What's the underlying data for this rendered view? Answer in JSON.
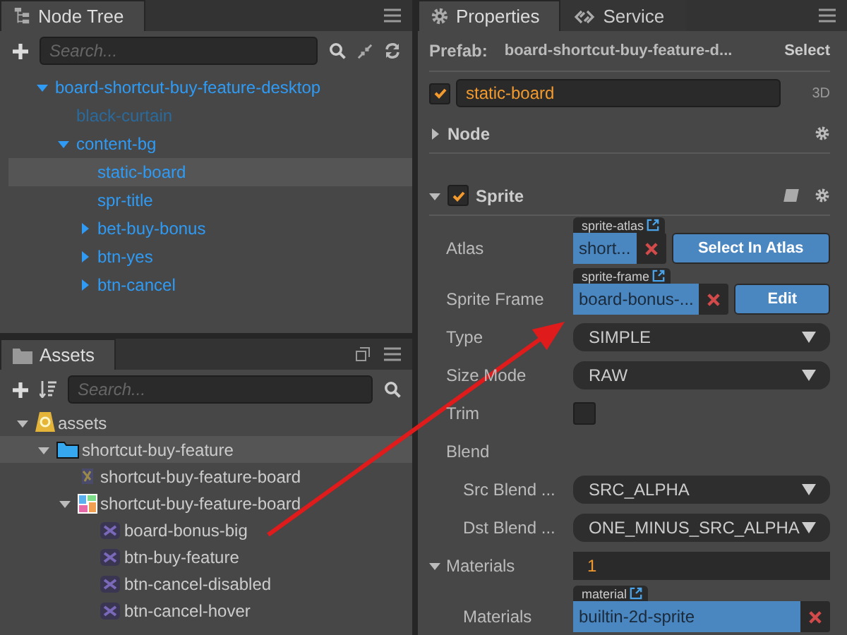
{
  "node_tree": {
    "title": "Node Tree",
    "search": {
      "placeholder": "Search..."
    },
    "nodes": [
      {
        "name": "board-shortcut-buy-feature-desktop",
        "expanded": true,
        "active": true,
        "selected": false,
        "children": [
          {
            "name": "black-curtain",
            "active": false,
            "selected": false
          },
          {
            "name": "content-bg",
            "expanded": true,
            "active": true,
            "selected": false,
            "children": [
              {
                "name": "static-board",
                "active": true,
                "selected": true
              },
              {
                "name": "spr-title",
                "active": true,
                "selected": false
              },
              {
                "name": "bet-buy-bonus",
                "expanded": false,
                "active": true,
                "selected": false
              },
              {
                "name": "btn-yes",
                "expanded": false,
                "active": true,
                "selected": false
              },
              {
                "name": "btn-cancel",
                "expanded": false,
                "active": true,
                "selected": false
              }
            ]
          }
        ]
      }
    ]
  },
  "assets": {
    "title": "Assets",
    "search": {
      "placeholder": "Search..."
    },
    "items": [
      {
        "name": "assets",
        "kind": "mount",
        "expanded": true,
        "selected": false,
        "children": [
          {
            "name": "shortcut-buy-feature",
            "kind": "folder",
            "expanded": true,
            "selected": true,
            "children": [
              {
                "name": "shortcut-buy-feature-board",
                "kind": "texture",
                "selected": false
              },
              {
                "name": "shortcut-buy-feature-board",
                "kind": "atlas",
                "expanded": true,
                "selected": false,
                "children": [
                  {
                    "name": "board-bonus-big",
                    "kind": "sprite",
                    "selected": false
                  },
                  {
                    "name": "btn-buy-feature",
                    "kind": "sprite",
                    "selected": false
                  },
                  {
                    "name": "btn-cancel-disabled",
                    "kind": "sprite",
                    "selected": false
                  },
                  {
                    "name": "btn-cancel-hover",
                    "kind": "sprite",
                    "selected": false
                  }
                ]
              }
            ]
          }
        ]
      }
    ]
  },
  "properties": {
    "tabs": [
      {
        "label": "Properties",
        "selected": true
      },
      {
        "label": "Service",
        "selected": false
      }
    ],
    "prefab": {
      "label": "Prefab:",
      "value": "board-shortcut-buy-feature-d...",
      "button": "Select"
    },
    "node": {
      "checked": true,
      "name": "static-board",
      "mode": "3D"
    },
    "sections": [
      {
        "title": "Node",
        "expanded": false
      },
      {
        "title": "Sprite",
        "expanded": true,
        "checked": true,
        "rows": [
          {
            "kind": "asset",
            "label": "Atlas",
            "tag": "sprite-atlas",
            "value": "short...",
            "button": "Select In Atlas"
          },
          {
            "kind": "asset",
            "label": "Sprite Frame",
            "tag": "sprite-frame",
            "value": "board-bonus-...",
            "button": "Edit"
          },
          {
            "kind": "select",
            "label": "Type",
            "value": "SIMPLE"
          },
          {
            "kind": "select",
            "label": "Size Mode",
            "value": "RAW"
          },
          {
            "kind": "checkbox",
            "label": "Trim",
            "checked": false
          },
          {
            "kind": "heading",
            "label": "Blend"
          },
          {
            "kind": "select",
            "label": "Src Blend ...",
            "value": "SRC_ALPHA",
            "indent": true
          },
          {
            "kind": "select",
            "label": "Dst Blend ...",
            "value": "ONE_MINUS_SRC_ALPHA",
            "indent": true
          },
          {
            "kind": "number",
            "label": "Materials",
            "value": "1",
            "expanded": true
          },
          {
            "kind": "asset",
            "label": "Materials",
            "tag": "material",
            "value": "builtin-2d-sprite",
            "indent": true
          }
        ]
      }
    ]
  }
}
